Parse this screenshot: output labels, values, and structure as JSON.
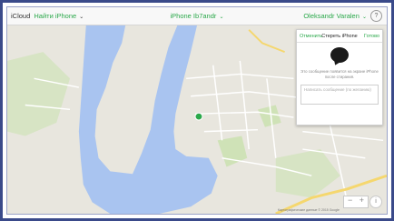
{
  "topbar": {
    "brand_main": "iCloud",
    "brand_app": "Найти iPhone",
    "device_name": "iPhone Ib7andr",
    "user_name": "Oleksandr Varalen",
    "help": "?"
  },
  "panel": {
    "cancel": "Отменить",
    "title": "Стереть iPhone",
    "done": "Готово",
    "info": "Это сообщение появится на экране iPhone после стирания.",
    "placeholder": "Написать сообщение (по желанию)"
  },
  "map": {
    "zoom_minus": "−",
    "zoom_plus": "+",
    "info": "i",
    "copyright": "Картографические данные © 2015 Google"
  },
  "colors": {
    "accent": "#2aa84a",
    "water": "#a9c4f0",
    "land": "#e7e5dd",
    "frame": "#3a4a8a"
  }
}
